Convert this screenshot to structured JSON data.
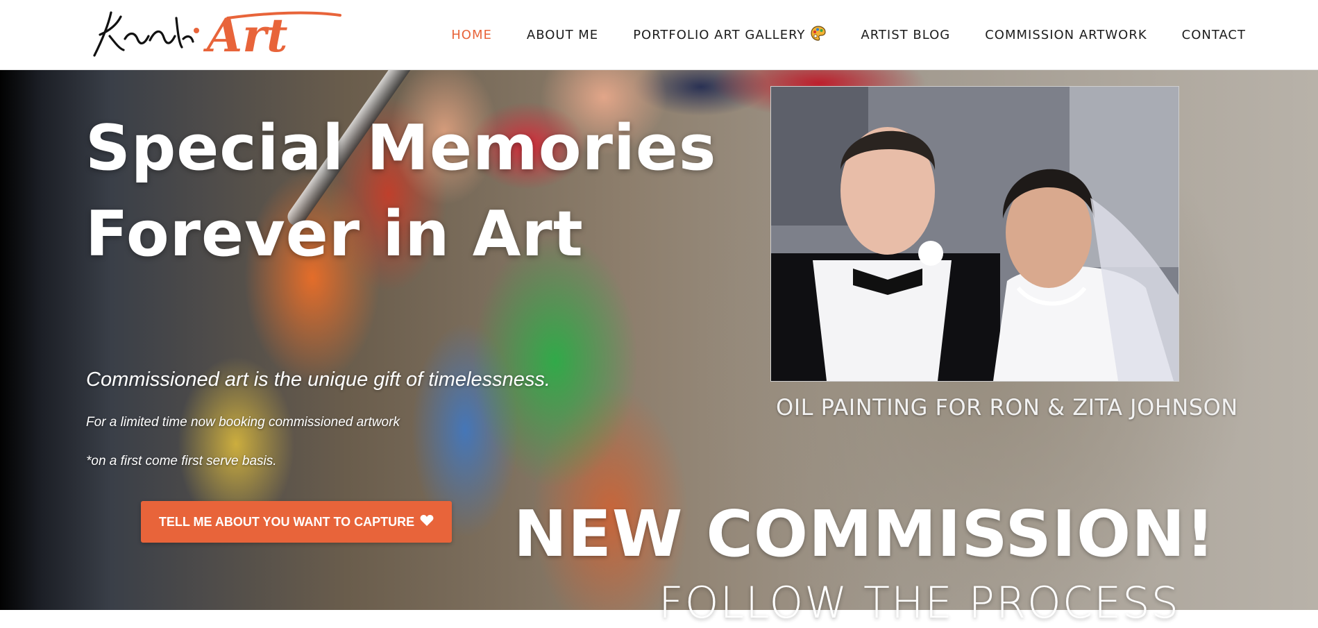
{
  "brand": {
    "logo_signature": "Krischi",
    "logo_word": "Art",
    "accent_color": "#e8643a"
  },
  "nav": {
    "items": [
      {
        "label": "HOME",
        "active": true
      },
      {
        "label": "ABOUT ME",
        "active": false
      },
      {
        "label": "PORTFOLIO ART GALLERY",
        "active": false,
        "icon": "palette-icon"
      },
      {
        "label": "ARTIST BLOG",
        "active": false
      },
      {
        "label": "COMMISSION ARTWORK",
        "active": false
      },
      {
        "label": "CONTACT",
        "active": false
      }
    ]
  },
  "hero": {
    "title_line1": "Special Memories",
    "title_line2": "Forever in Art",
    "subtitle": "Commissioned art is the unique gift of timelessness.",
    "note1": "For a limited time now booking commissioned artwork",
    "note2": "*on a first come first serve basis.",
    "cta_label": "TELL ME ABOUT YOU WANT TO CAPTURE",
    "cta_icon": "heart-icon"
  },
  "featured": {
    "caption": "OIL PAINTING FOR RON & ZITA JOHNSON",
    "headline": "NEW COMMISSION!",
    "subheadline": "FOLLOW THE PROCESS"
  }
}
